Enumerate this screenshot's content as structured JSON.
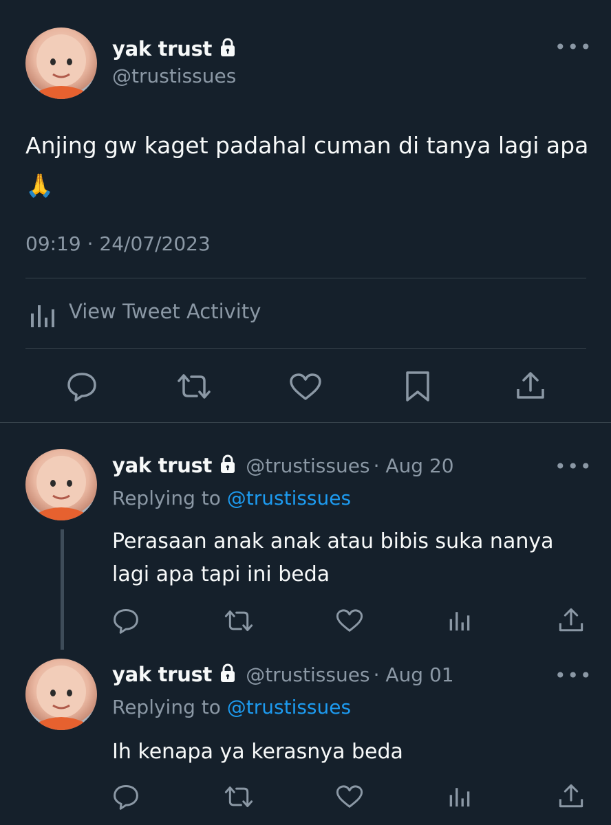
{
  "main_tweet": {
    "display_name": "yak trust",
    "handle": "@trustissues",
    "text": "Anjing gw kaget padahal cuman di tanya lagi apa🙏",
    "timestamp": "09:19 · 24/07/2023",
    "activity_label": "View Tweet Activity"
  },
  "replies": [
    {
      "display_name": "yak trust",
      "handle": "@trustissues",
      "date": "· Aug 20",
      "replying_prefix": "Replying to",
      "replying_to": "@trustissues",
      "text": "Perasaan anak anak atau bibis suka nanya lagi apa tapi ini beda"
    },
    {
      "display_name": "yak trust",
      "handle": "@trustissues",
      "date": "· Aug 01",
      "replying_prefix": "Replying to",
      "replying_to": "@trustissues",
      "text": "Ih kenapa ya kerasnya beda"
    }
  ],
  "more_glyph": "•••",
  "colors": {
    "background": "#15202b",
    "text": "#f7f9f9",
    "muted": "#8b98a5",
    "link": "#1d9bf0",
    "divider": "#38444d",
    "thread_line": "#3e4c59"
  },
  "icons": [
    "lock-icon",
    "more-icon",
    "reply-icon",
    "retweet-icon",
    "like-icon",
    "bookmark-icon",
    "share-icon",
    "analytics-icon"
  ]
}
